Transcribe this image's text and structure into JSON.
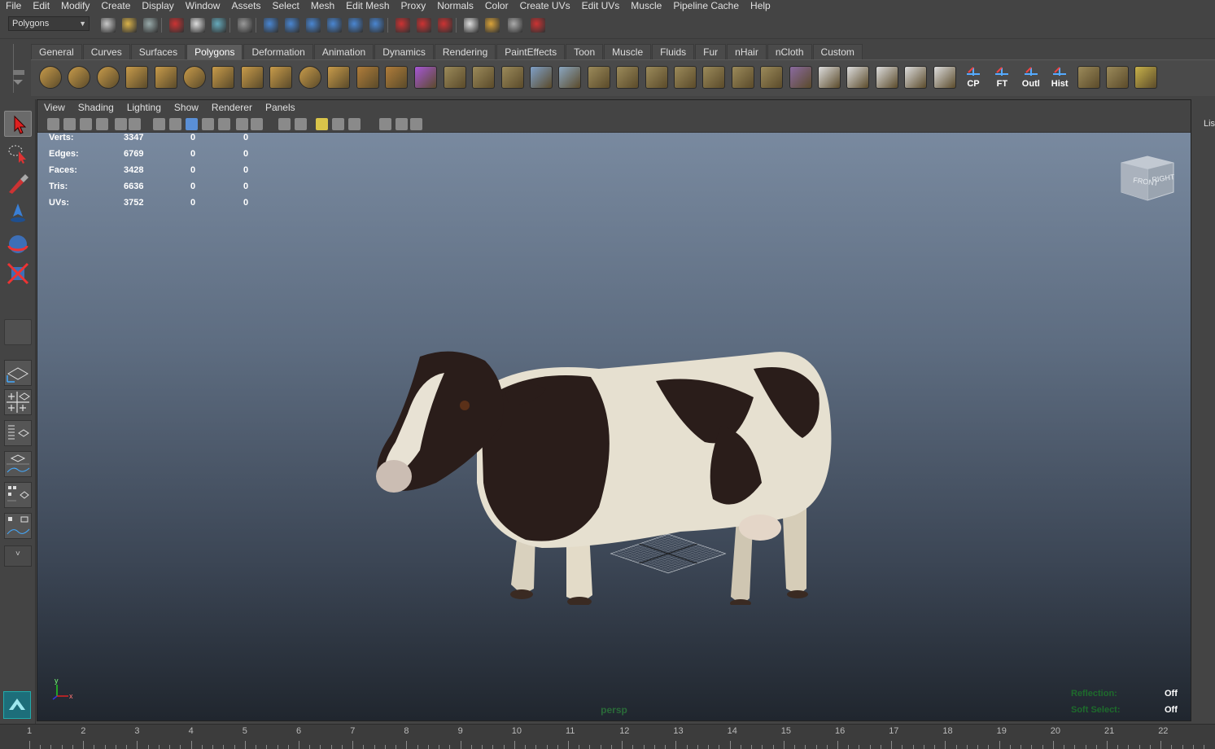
{
  "menubar": {
    "items": [
      "File",
      "Edit",
      "Modify",
      "Create",
      "Display",
      "Window",
      "Assets",
      "Select",
      "Mesh",
      "Edit Mesh",
      "Proxy",
      "Normals",
      "Color",
      "Create UVs",
      "Edit UVs",
      "Muscle",
      "Pipeline Cache",
      "Help"
    ]
  },
  "statusline": {
    "mode_value": "Polygons",
    "icons": [
      "new-scene-icon",
      "open-scene-icon",
      "save-scene-icon",
      "select-hierarchy-icon",
      "select-object-icon",
      "select-component-icon",
      "filter-icon",
      "snap-grid-icon",
      "snap-curve-icon",
      "snap-point-icon",
      "snap-plane-icon",
      "snap-surface-icon",
      "construction-history-icon",
      "render-icon",
      "ipr-icon",
      "render-settings-icon",
      "help-icon",
      "lock-icon",
      "selection-mask-icon",
      "magnet-icon"
    ]
  },
  "shelf": {
    "tabs": [
      "General",
      "Curves",
      "Surfaces",
      "Polygons",
      "Deformation",
      "Animation",
      "Dynamics",
      "Rendering",
      "PaintEffects",
      "Toon",
      "Muscle",
      "Fluids",
      "Fur",
      "nHair",
      "nCloth",
      "Custom"
    ],
    "active_tab": "Polygons",
    "labels": {
      "cp": "CP",
      "ft": "FT",
      "outl": "Outl",
      "hist": "Hist"
    }
  },
  "viewport": {
    "menu": [
      "View",
      "Shading",
      "Lighting",
      "Show",
      "Renderer",
      "Panels"
    ],
    "hud": [
      {
        "label": "Verts:",
        "v1": "3347",
        "v2": "0",
        "v3": "0"
      },
      {
        "label": "Edges:",
        "v1": "6769",
        "v2": "0",
        "v3": "0"
      },
      {
        "label": "Faces:",
        "v1": "3428",
        "v2": "0",
        "v3": "0"
      },
      {
        "label": "Tris:",
        "v1": "6636",
        "v2": "0",
        "v3": "0"
      },
      {
        "label": "UVs:",
        "v1": "3752",
        "v2": "0",
        "v3": "0"
      }
    ],
    "viewcube": {
      "front": "FRONT",
      "right": "RIGHT"
    },
    "camera": "persp",
    "axis": {
      "y": "y",
      "x": "x"
    },
    "bottom_hud": [
      {
        "key": "Reflection:",
        "value": "Off"
      },
      {
        "key": "Soft Select:",
        "value": "Off"
      }
    ]
  },
  "right_panel": {
    "label": "Lis"
  },
  "timeline": {
    "numbers": [
      "1",
      "2",
      "3",
      "4",
      "5",
      "6",
      "7",
      "8",
      "9",
      "10",
      "11",
      "12",
      "13",
      "14",
      "15",
      "16",
      "17",
      "18",
      "19",
      "20",
      "21",
      "22"
    ]
  },
  "colors": {
    "accent": "#5d5d5d",
    "hud_green": "#1e6b2c"
  }
}
